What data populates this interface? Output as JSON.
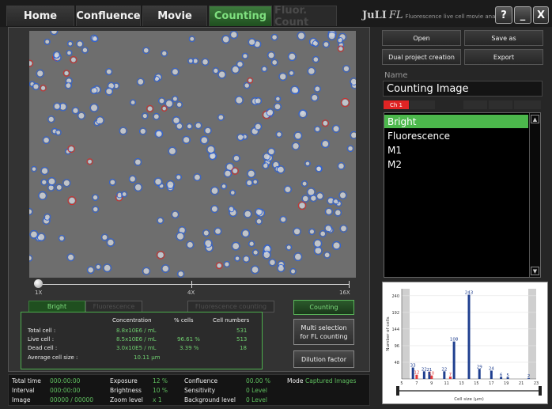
{
  "tabs": [
    {
      "label": "Home",
      "state": "normal"
    },
    {
      "label": "Confluence",
      "state": "normal"
    },
    {
      "label": "Movie",
      "state": "normal"
    },
    {
      "label": "Counting",
      "state": "active"
    },
    {
      "label": "Fluor. Count",
      "state": "disabled"
    }
  ],
  "brand": {
    "name": "JuLI",
    "italic": "FL",
    "tagline": "Fluorescence live cell movie analyzer"
  },
  "window_buttons": {
    "help": "?",
    "minimize": "_",
    "close": "X"
  },
  "zoom": {
    "min": "1X",
    "mid": "4X",
    "max": "16X",
    "level_fraction": 0.0
  },
  "subtabs": {
    "bright": "Bright",
    "fluorescence": "Fluorescence",
    "merge": "Fluorescence counting"
  },
  "stats": {
    "headers": {
      "concentration": "Concentration",
      "pct": "% cells",
      "numbers": "Cell numbers"
    },
    "rows": [
      {
        "label": "Total cell :",
        "concentration": "8.8x10E6 / mL",
        "pct": "",
        "numbers": "531"
      },
      {
        "label": "Live cell :",
        "concentration": "8.5x10E6 / mL",
        "pct": "96.61 %",
        "numbers": "513"
      },
      {
        "label": "Dead cell :",
        "concentration": "3.0x10E5 / mL",
        "pct": "3.39 %",
        "numbers": "18"
      }
    ],
    "avg_label": "Average cell size :",
    "avg_value": "10.11 μm"
  },
  "right_buttons": {
    "counting": "Counting",
    "multi_1": "Multi selection",
    "multi_2": "for FL counting",
    "dilution": "Dilution factor"
  },
  "bottom": {
    "total_time_label": "Total time",
    "total_time": "000:00:00",
    "interval_label": "Interval",
    "interval": "000:00:00",
    "image_label": "Image",
    "image": "00000 / 00000",
    "exposure_label": "Exposure",
    "exposure": "12 %",
    "brightness_label": "Brightness",
    "brightness": "10 %",
    "zoom_label": "Zoom level",
    "zoom": "x 1",
    "confluence_label": "Confluence",
    "confluence": "00.00 %",
    "sensitivity_label": "Sensitivity",
    "sensitivity": "0 Level",
    "background_label": "Background level",
    "background": "0 Level",
    "mode_label": "Mode",
    "mode": "Captured Images"
  },
  "project": {
    "open": "Open",
    "save_as": "Save as",
    "dual": "Dual project creation",
    "export": "Export"
  },
  "name_label": "Name",
  "name_value": "Counting Image",
  "channels": {
    "ch1": "Ch 1"
  },
  "image_list": [
    "Bright",
    "Fluorescence",
    "M1",
    "M2"
  ],
  "chart_data": {
    "type": "bar",
    "xlabel": "Cell size (μm)",
    "ylabel": "Number of cells",
    "xlim": [
      5,
      23
    ],
    "ylim": [
      0,
      260
    ],
    "xticks": [
      5,
      7,
      9,
      11,
      13,
      15,
      17,
      19,
      21,
      23
    ],
    "yticks": [
      48,
      96,
      144,
      192,
      240
    ],
    "series": [
      {
        "color": "#1f3f8f",
        "x": [
          6.5,
          8,
          8.7,
          10.7,
          12,
          14,
          15.4,
          17,
          18.3,
          19.2,
          22
        ],
        "values": [
          33,
          22,
          21,
          22,
          108,
          243,
          29,
          24,
          6,
          5,
          2
        ]
      },
      {
        "color": "#e23b3b",
        "x": [
          7,
          9,
          11.5
        ],
        "values": [
          12,
          10,
          7
        ]
      }
    ]
  },
  "colors": {
    "accent": "#4cb84c",
    "text_green": "#6fcf6f",
    "cell_blue": "#2f63d8",
    "cell_red": "#d62a2a"
  }
}
